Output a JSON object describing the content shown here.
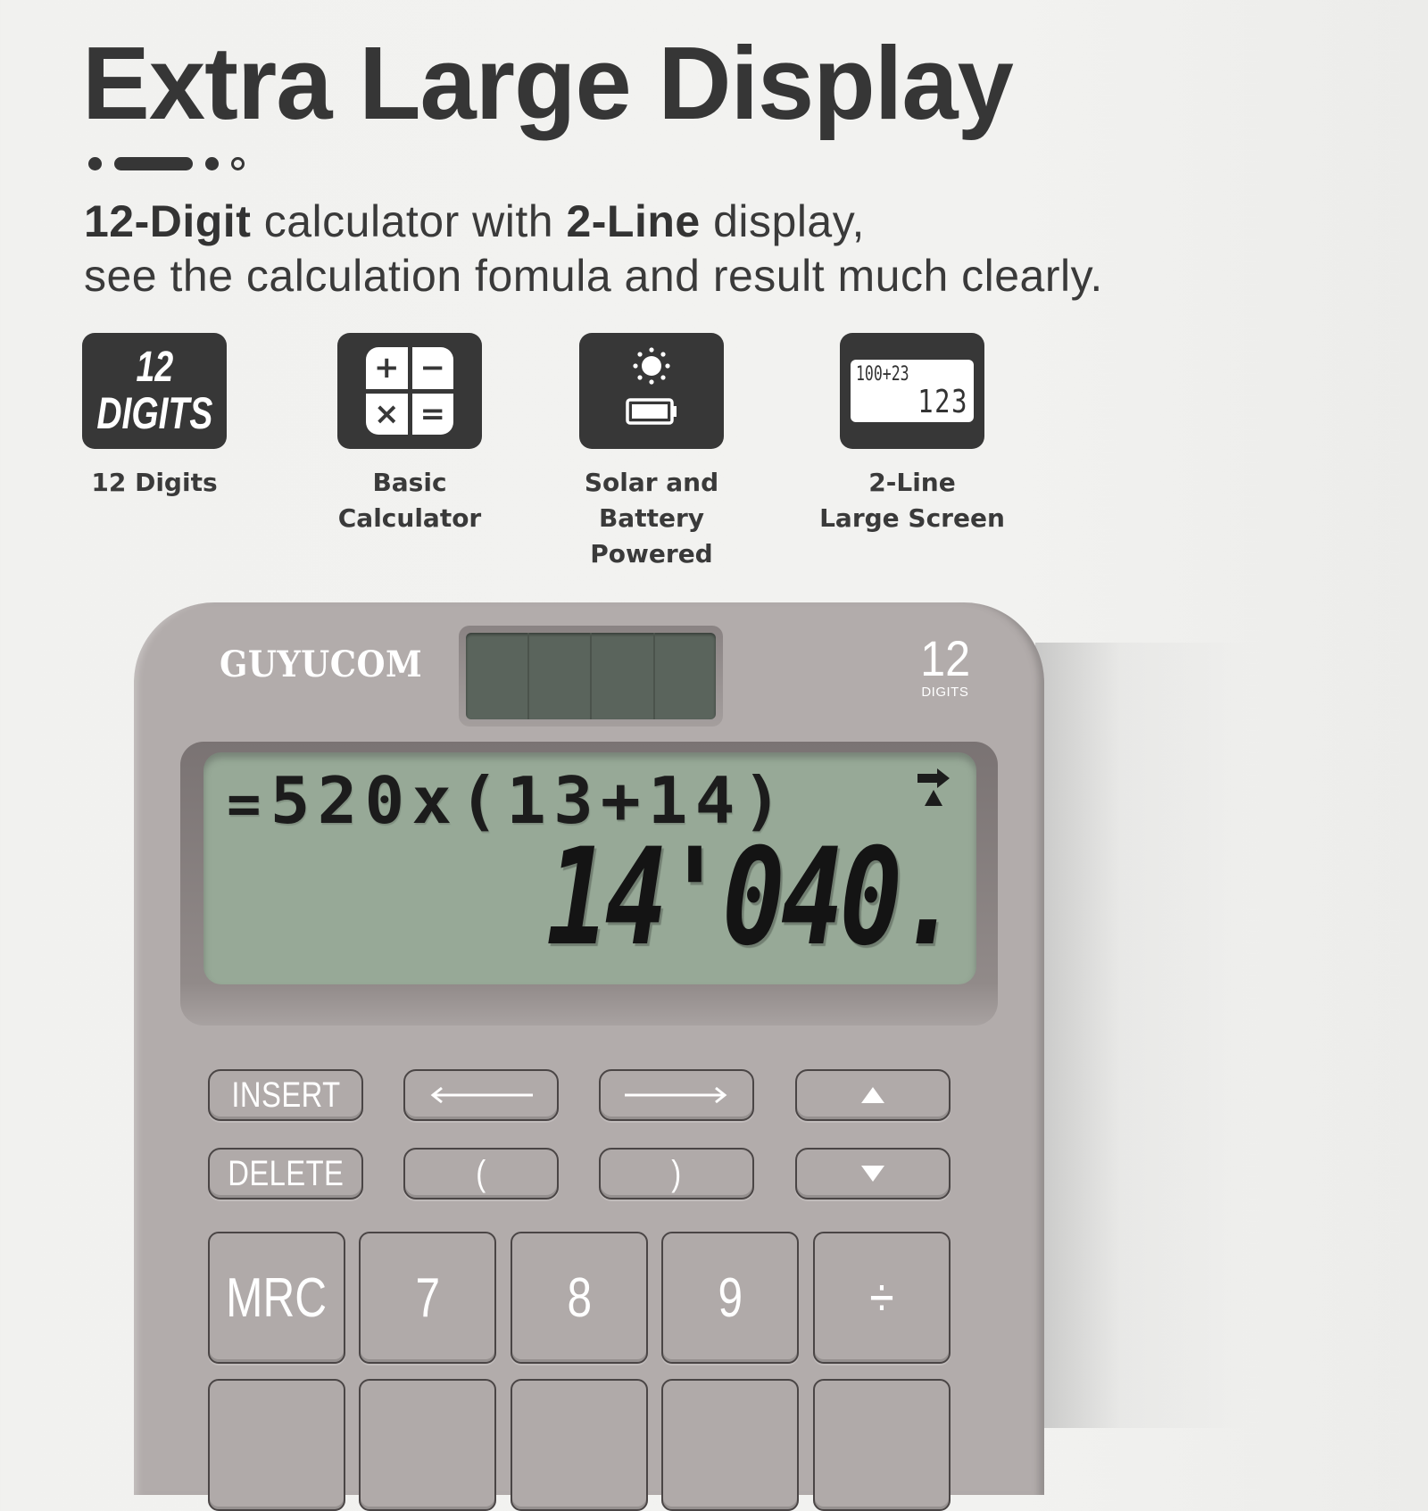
{
  "header": {
    "title": "Extra Large Display",
    "subtitle_line1": {
      "bold1": "12-Digit",
      "text1": " calculator with ",
      "bold2": "2-Line",
      "text2": " display,"
    },
    "subtitle_line2": "see the calculation fomula and result much clearly."
  },
  "features": [
    {
      "icon": "twelve-digits-icon",
      "tile_top": "12",
      "tile_bottom": "DIGITS",
      "label_line1": "12 Digits",
      "label_line2": ""
    },
    {
      "icon": "calculator-icon",
      "symbols": [
        "+",
        "−",
        "×",
        "="
      ],
      "label_line1": "Basic",
      "label_line2": "Calculator"
    },
    {
      "icon": "solar-battery-icon",
      "label_line1": "Solar and",
      "label_line2": "Battery Powered"
    },
    {
      "icon": "two-line-screen-icon",
      "screen_line1": "100+23",
      "screen_line2": "123",
      "label_line1": "2-Line",
      "label_line2": "Large Screen"
    }
  ],
  "calculator": {
    "brand": "GUYUCOM",
    "badge_number": "12",
    "badge_text": "DIGITS",
    "display": {
      "prefix": "=",
      "formula": "520x(13+14)",
      "result": "14'040.",
      "indicators": [
        "right-arrow-indicator",
        "up-triangle-indicator"
      ]
    },
    "function_keys": [
      [
        "INSERT",
        "←",
        "→",
        "▲"
      ],
      [
        "DELETE",
        "(",
        ")",
        "▼"
      ]
    ],
    "main_keys": [
      [
        "MRC",
        "7",
        "8",
        "9",
        "÷"
      ],
      [
        "",
        "",
        "",
        "",
        ""
      ]
    ],
    "colors": {
      "body": "#b2acab",
      "lcd": "#97a997",
      "solar": "#5a645c",
      "text_dark": "#363636"
    }
  }
}
